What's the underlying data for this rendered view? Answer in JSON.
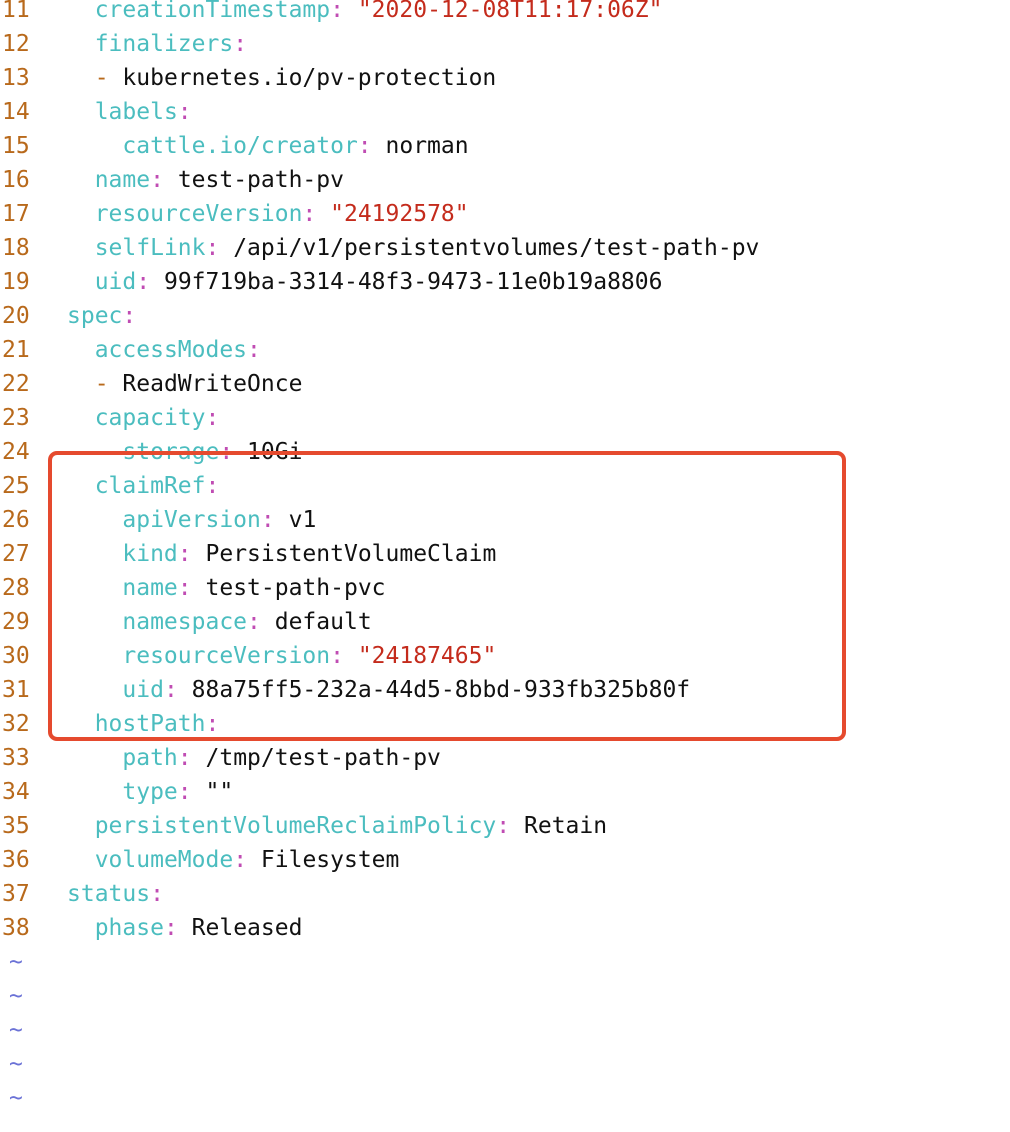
{
  "editor": {
    "lines": [
      {
        "num": "11",
        "indent": "  ",
        "dash": "",
        "key": "creationTimestamp",
        "value": "\"2020-12-08T11:17:06Z\"",
        "value_type": "string"
      },
      {
        "num": "12",
        "indent": "  ",
        "dash": "",
        "key": "finalizers",
        "value": "",
        "value_type": "plain"
      },
      {
        "num": "13",
        "indent": "  ",
        "dash": "- ",
        "key": "",
        "value": "kubernetes.io/pv-protection",
        "value_type": "plain"
      },
      {
        "num": "14",
        "indent": "  ",
        "dash": "",
        "key": "labels",
        "value": "",
        "value_type": "plain"
      },
      {
        "num": "15",
        "indent": "    ",
        "dash": "",
        "key": "cattle.io/creator",
        "value": "norman",
        "value_type": "plain"
      },
      {
        "num": "16",
        "indent": "  ",
        "dash": "",
        "key": "name",
        "value": "test-path-pv",
        "value_type": "plain"
      },
      {
        "num": "17",
        "indent": "  ",
        "dash": "",
        "key": "resourceVersion",
        "value": "\"24192578\"",
        "value_type": "string"
      },
      {
        "num": "18",
        "indent": "  ",
        "dash": "",
        "key": "selfLink",
        "value": "/api/v1/persistentvolumes/test-path-pv",
        "value_type": "plain"
      },
      {
        "num": "19",
        "indent": "  ",
        "dash": "",
        "key": "uid",
        "value": "99f719ba-3314-48f3-9473-11e0b19a8806",
        "value_type": "plain"
      },
      {
        "num": "20",
        "indent": "",
        "dash": "",
        "key": "spec",
        "value": "",
        "value_type": "plain"
      },
      {
        "num": "21",
        "indent": "  ",
        "dash": "",
        "key": "accessModes",
        "value": "",
        "value_type": "plain"
      },
      {
        "num": "22",
        "indent": "  ",
        "dash": "- ",
        "key": "",
        "value": "ReadWriteOnce",
        "value_type": "plain"
      },
      {
        "num": "23",
        "indent": "  ",
        "dash": "",
        "key": "capacity",
        "value": "",
        "value_type": "plain"
      },
      {
        "num": "24",
        "indent": "    ",
        "dash": "",
        "key": "storage",
        "value": "10Gi",
        "value_type": "plain"
      },
      {
        "num": "25",
        "indent": "  ",
        "dash": "",
        "key": "claimRef",
        "value": "",
        "value_type": "plain"
      },
      {
        "num": "26",
        "indent": "    ",
        "dash": "",
        "key": "apiVersion",
        "value": "v1",
        "value_type": "plain"
      },
      {
        "num": "27",
        "indent": "    ",
        "dash": "",
        "key": "kind",
        "value": "PersistentVolumeClaim",
        "value_type": "plain"
      },
      {
        "num": "28",
        "indent": "    ",
        "dash": "",
        "key": "name",
        "value": "test-path-pvc",
        "value_type": "plain"
      },
      {
        "num": "29",
        "indent": "    ",
        "dash": "",
        "key": "namespace",
        "value": "default",
        "value_type": "plain"
      },
      {
        "num": "30",
        "indent": "    ",
        "dash": "",
        "key": "resourceVersion",
        "value": "\"24187465\"",
        "value_type": "string"
      },
      {
        "num": "31",
        "indent": "    ",
        "dash": "",
        "key": "uid",
        "value": "88a75ff5-232a-44d5-8bbd-933fb325b80f",
        "value_type": "plain"
      },
      {
        "num": "32",
        "indent": "  ",
        "dash": "",
        "key": "hostPath",
        "value": "",
        "value_type": "plain"
      },
      {
        "num": "33",
        "indent": "    ",
        "dash": "",
        "key": "path",
        "value": "/tmp/test-path-pv",
        "value_type": "plain"
      },
      {
        "num": "34",
        "indent": "    ",
        "dash": "",
        "key": "type",
        "value": "\"\"",
        "value_type": "plain"
      },
      {
        "num": "35",
        "indent": "  ",
        "dash": "",
        "key": "persistentVolumeReclaimPolicy",
        "value": "Retain",
        "value_type": "plain"
      },
      {
        "num": "36",
        "indent": "  ",
        "dash": "",
        "key": "volumeMode",
        "value": "Filesystem",
        "value_type": "plain"
      },
      {
        "num": "37",
        "indent": "",
        "dash": "",
        "key": "status",
        "value": "",
        "value_type": "plain"
      },
      {
        "num": "38",
        "indent": "  ",
        "dash": "",
        "key": "phase",
        "value": "Released",
        "value_type": "plain"
      }
    ],
    "tilde_marker": "~",
    "tilde_count": 5
  },
  "colors": {
    "line_number": "#b8691b",
    "key": "#4bbdbf",
    "colon": "#c04cb3",
    "string": "#c42b1c",
    "plain_value": "#111111",
    "tilde": "#6b72d6",
    "highlight_border": "#e54a2e"
  }
}
